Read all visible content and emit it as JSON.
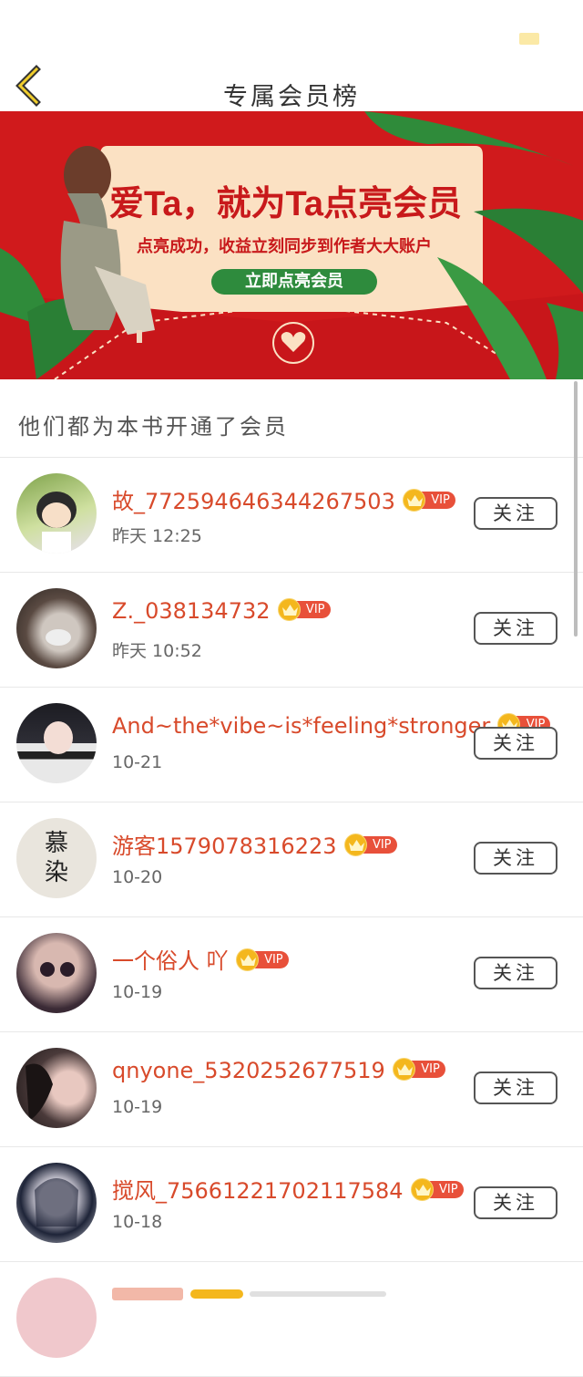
{
  "nav": {
    "title": "专属会员榜",
    "back_icon": "chevron-left-icon"
  },
  "banner": {
    "headline": "爱Ta，就为Ta点亮会员",
    "subtitle": "点亮成功，收益立刻同步到作者大大账户",
    "cta": "立即点亮会员",
    "background_color": "#d01a1c",
    "seal_icon": "heart-seal-icon"
  },
  "section": {
    "title": "他们都为本书开通了会员"
  },
  "vip_badge": {
    "label": "VIP",
    "icon": "crown-icon"
  },
  "members": [
    {
      "name": "故_772594646344267503",
      "time": "昨天 12:25",
      "follow_label": "关注"
    },
    {
      "name": "Z._038134732",
      "time": "昨天 10:52",
      "follow_label": "关注"
    },
    {
      "name": "And~the*vibe~is*feeling*stronger",
      "time": "10-21",
      "follow_label": "关注"
    },
    {
      "name": "游客1579078316223",
      "time": "10-20",
      "follow_label": "关注",
      "avatar_text": "慕染"
    },
    {
      "name": "一个俗人 吖",
      "time": "10-19",
      "follow_label": "关注"
    },
    {
      "name": "qnyone_5320252677519",
      "time": "10-19",
      "follow_label": "关注"
    },
    {
      "name": "搅风_75661221702117584",
      "time": "10-18",
      "follow_label": "关注"
    },
    {
      "name": "",
      "time": "",
      "follow_label": ""
    }
  ],
  "colors": {
    "username": "#d84a2b",
    "vip_pill": "#e8503a",
    "crown": "#f4b71d",
    "cta_green": "#2e8b3d"
  }
}
